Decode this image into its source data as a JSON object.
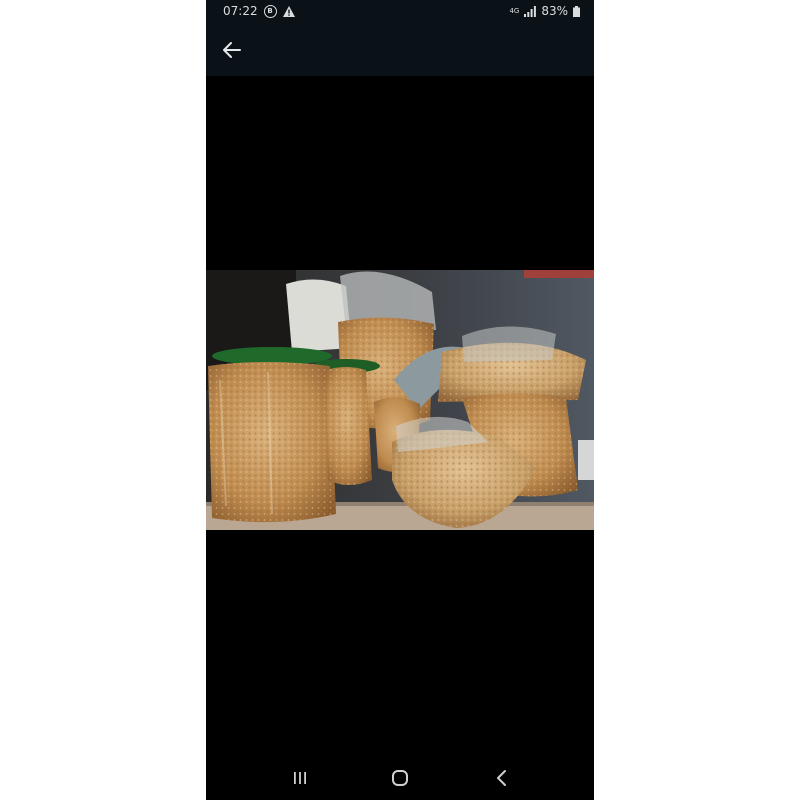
{
  "status_bar": {
    "time": "07:22",
    "notification_letter": "B",
    "alert_icon": "warning-icon",
    "network_label": "4G",
    "battery": "83%"
  },
  "app_bar": {
    "back_icon": "arrow-left-icon"
  },
  "viewer": {
    "image_icon": "product-photo"
  },
  "nav_bar": {
    "recents_icon": "recent-apps-icon",
    "home_icon": "home-icon",
    "back_icon": "back-chevron-icon"
  },
  "colors": {
    "status_bg": "#0b1217",
    "status_text": "#d9dde0",
    "viewer_bg": "#000000"
  }
}
